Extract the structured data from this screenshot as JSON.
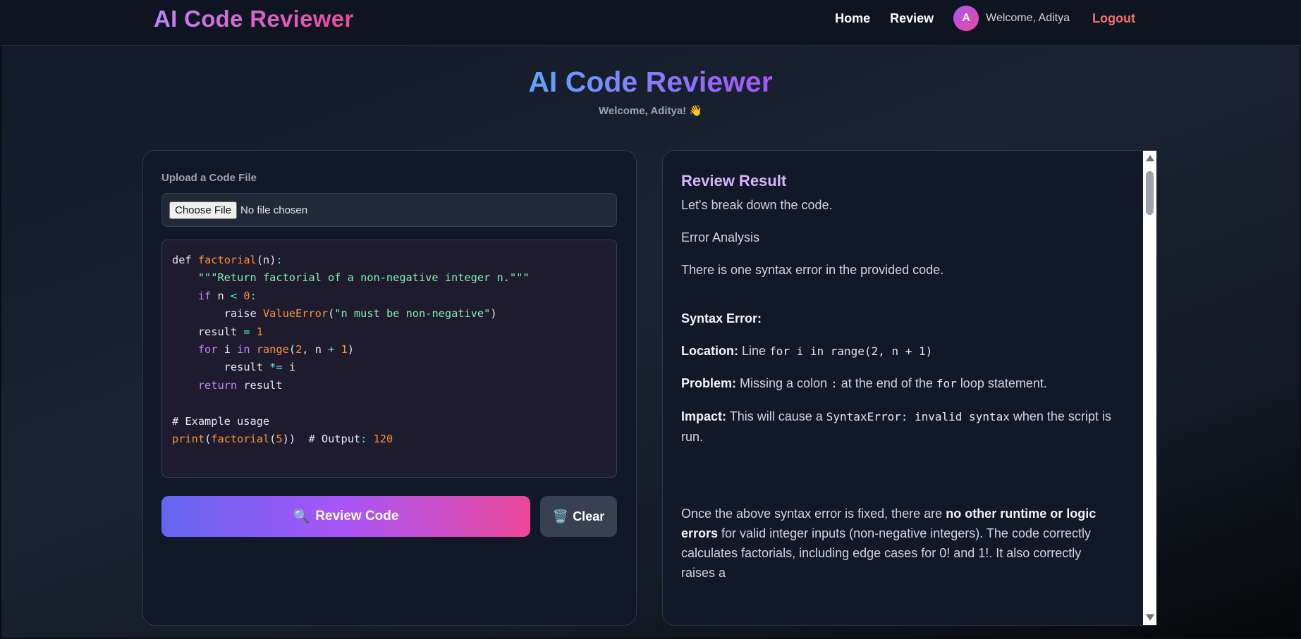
{
  "navbar": {
    "brand": "AI Code Reviewer",
    "links": {
      "home": "Home",
      "review": "Review"
    },
    "avatar_initial": "A",
    "welcome": "Welcome, Aditya",
    "logout": "Logout"
  },
  "hero": {
    "title": "AI Code Reviewer",
    "subtitle": "Welcome, Aditya! 👋"
  },
  "upload": {
    "label": "Upload a Code File",
    "choose_button": "Choose File",
    "file_status": "No file chosen"
  },
  "code_lines": [
    "def factorial(n):",
    "    \"\"\"Return factorial of a non-negative integer n.\"\"\"",
    "    if n < 0:",
    "        raise ValueError(\"n must be non-negative\")",
    "    result = 1",
    "    for i in range(2, n + 1)",
    "        result *= i",
    "    return result",
    "",
    "# Example usage",
    "print(factorial(5))  # Output: 120"
  ],
  "actions": {
    "review_icon": "🔍",
    "review_label": "Review Code",
    "clear_icon": "🗑️",
    "clear_label": "Clear"
  },
  "result": {
    "title": "Review Result",
    "intro": "Let's break down the code.",
    "analysis_heading": "Error Analysis",
    "summary": "There is one syntax error in the provided code.",
    "syntax_error_heading": "Syntax Error:",
    "location_label": "Location:",
    "location_text": "Line",
    "location_code": "for i in range(2, n + 1)",
    "problem_label": "Problem:",
    "problem_pre": "Missing a colon",
    "problem_code1": ":",
    "problem_mid": "at the end of the",
    "problem_code2": "for",
    "problem_post": "loop statement.",
    "impact_label": "Impact:",
    "impact_pre": "This will cause a",
    "impact_code": "SyntaxError: invalid syntax",
    "impact_post": "when the script is run.",
    "final_pre": "Once the above syntax error is fixed, there are",
    "final_bold": "no other runtime or logic errors",
    "final_post": "for valid integer inputs (non-negative integers). The code correctly calculates factorials, including edge cases for 0! and 1!. It also correctly raises a"
  }
}
